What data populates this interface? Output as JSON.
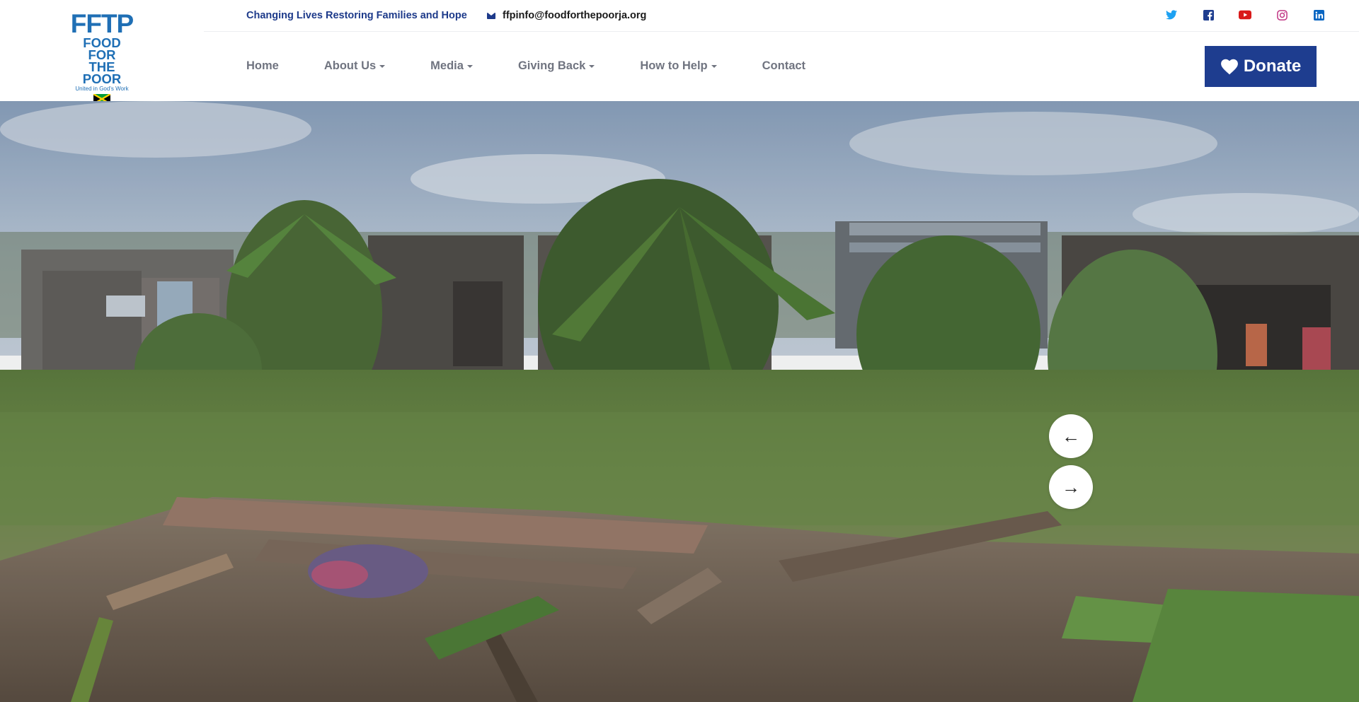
{
  "brand": {
    "logo_mark": "FFTP",
    "logo_line1": "FOOD FOR",
    "logo_line2": "THE POOR",
    "logo_tagline": "United in God's Work",
    "primary_color": "#1e3d8f",
    "logo_color": "#1f6fb5"
  },
  "topbar": {
    "tagline": "Changing Lives Restoring Families and Hope",
    "email": "ffpinfo@foodforthepoorja.org",
    "email_icon": "envelope-icon",
    "social": [
      {
        "name": "twitter-icon",
        "color": "#1da1f2"
      },
      {
        "name": "facebook-icon",
        "color": "#1e3d8f"
      },
      {
        "name": "youtube-icon",
        "color": "#d91a1a"
      },
      {
        "name": "instagram-icon",
        "color": "#c13584"
      },
      {
        "name": "linkedin-icon",
        "color": "#0a66c2"
      }
    ]
  },
  "nav": {
    "items": [
      {
        "label": "Home",
        "dropdown": false
      },
      {
        "label": "About Us",
        "dropdown": true
      },
      {
        "label": "Media",
        "dropdown": true
      },
      {
        "label": "Giving Back",
        "dropdown": true
      },
      {
        "label": "How to Help",
        "dropdown": true
      },
      {
        "label": "Contact",
        "dropdown": false
      }
    ]
  },
  "donate": {
    "label": "Donate",
    "icon": "heart-icon"
  },
  "hero": {
    "prev_label": "←",
    "next_label": "→"
  }
}
